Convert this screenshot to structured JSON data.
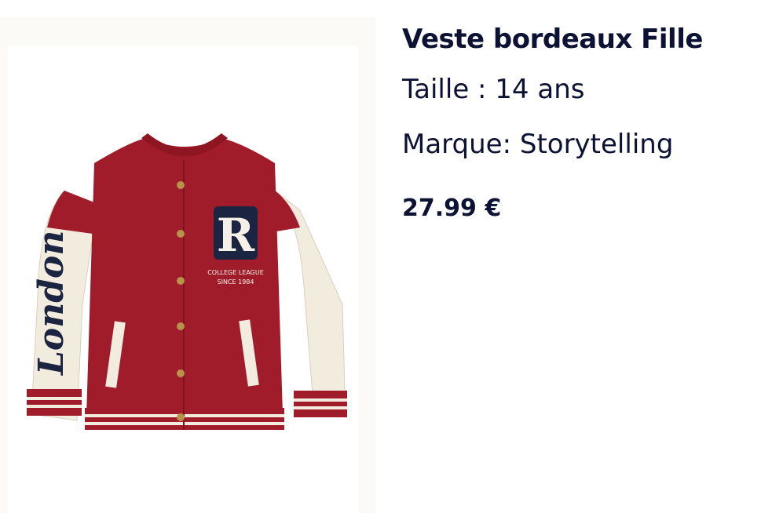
{
  "product": {
    "image_alt": "Veste bordeaux Fille",
    "title": "Veste bordeaux Fille",
    "size": "Taille : 14 ans",
    "brand": "Marque: Storytelling",
    "price": "27.99 €",
    "patch_letter": "R",
    "patch_text_line1": "COLLEGE LEAGUE",
    "patch_text_line2": "SINCE 1984",
    "sleeve_text": "London"
  },
  "colors": {
    "text": "#0c1233",
    "jacket_body": "#a11c2a",
    "jacket_sleeves": "#f2ecdf",
    "patch_navy": "#1b2440"
  }
}
